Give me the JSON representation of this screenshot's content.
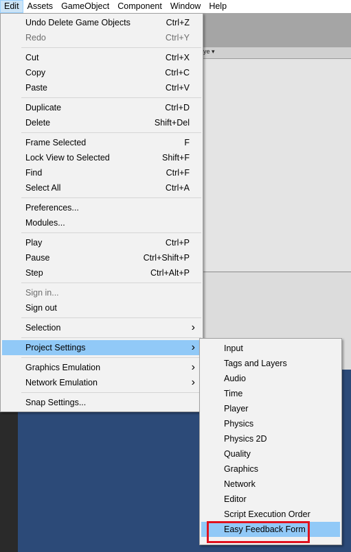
{
  "menubar": {
    "items": [
      "Edit",
      "Assets",
      "GameObject",
      "Component",
      "Window",
      "Help"
    ],
    "active": "Edit"
  },
  "background": {
    "tab_fragment": "ye ▾"
  },
  "edit_menu": {
    "groups": [
      [
        {
          "label": "Undo Delete Game Objects",
          "shortcut": "Ctrl+Z"
        },
        {
          "label": "Redo",
          "shortcut": "Ctrl+Y",
          "disabled": true
        }
      ],
      [
        {
          "label": "Cut",
          "shortcut": "Ctrl+X"
        },
        {
          "label": "Copy",
          "shortcut": "Ctrl+C"
        },
        {
          "label": "Paste",
          "shortcut": "Ctrl+V"
        }
      ],
      [
        {
          "label": "Duplicate",
          "shortcut": "Ctrl+D"
        },
        {
          "label": "Delete",
          "shortcut": "Shift+Del"
        }
      ],
      [
        {
          "label": "Frame Selected",
          "shortcut": "F"
        },
        {
          "label": "Lock View to Selected",
          "shortcut": "Shift+F"
        },
        {
          "label": "Find",
          "shortcut": "Ctrl+F"
        },
        {
          "label": "Select All",
          "shortcut": "Ctrl+A"
        }
      ],
      [
        {
          "label": "Preferences...",
          "shortcut": ""
        },
        {
          "label": "Modules...",
          "shortcut": ""
        }
      ],
      [
        {
          "label": "Play",
          "shortcut": "Ctrl+P"
        },
        {
          "label": "Pause",
          "shortcut": "Ctrl+Shift+P"
        },
        {
          "label": "Step",
          "shortcut": "Ctrl+Alt+P"
        }
      ],
      [
        {
          "label": "Sign in...",
          "shortcut": "",
          "disabled": true
        },
        {
          "label": "Sign out",
          "shortcut": ""
        }
      ],
      [
        {
          "label": "Selection",
          "shortcut": "",
          "submenu": true
        }
      ],
      [
        {
          "label": "Project Settings",
          "shortcut": "",
          "submenu": true,
          "highlighted": true
        }
      ],
      [
        {
          "label": "Graphics Emulation",
          "shortcut": "",
          "submenu": true
        },
        {
          "label": "Network Emulation",
          "shortcut": "",
          "submenu": true
        }
      ],
      [
        {
          "label": "Snap Settings...",
          "shortcut": ""
        }
      ]
    ]
  },
  "project_settings_submenu": {
    "items": [
      {
        "label": "Input"
      },
      {
        "label": "Tags and Layers"
      },
      {
        "label": "Audio"
      },
      {
        "label": "Time"
      },
      {
        "label": "Player"
      },
      {
        "label": "Physics"
      },
      {
        "label": "Physics 2D"
      },
      {
        "label": "Quality"
      },
      {
        "label": "Graphics"
      },
      {
        "label": "Network"
      },
      {
        "label": "Editor"
      },
      {
        "label": "Script Execution Order"
      },
      {
        "label": "Easy Feedback Form",
        "highlighted": true
      }
    ]
  },
  "colors": {
    "highlight": "#91c9f7",
    "annotation_box": "#e0121e",
    "menu_bg": "#f2f2f2",
    "disabled_text": "#6d6d6d"
  }
}
